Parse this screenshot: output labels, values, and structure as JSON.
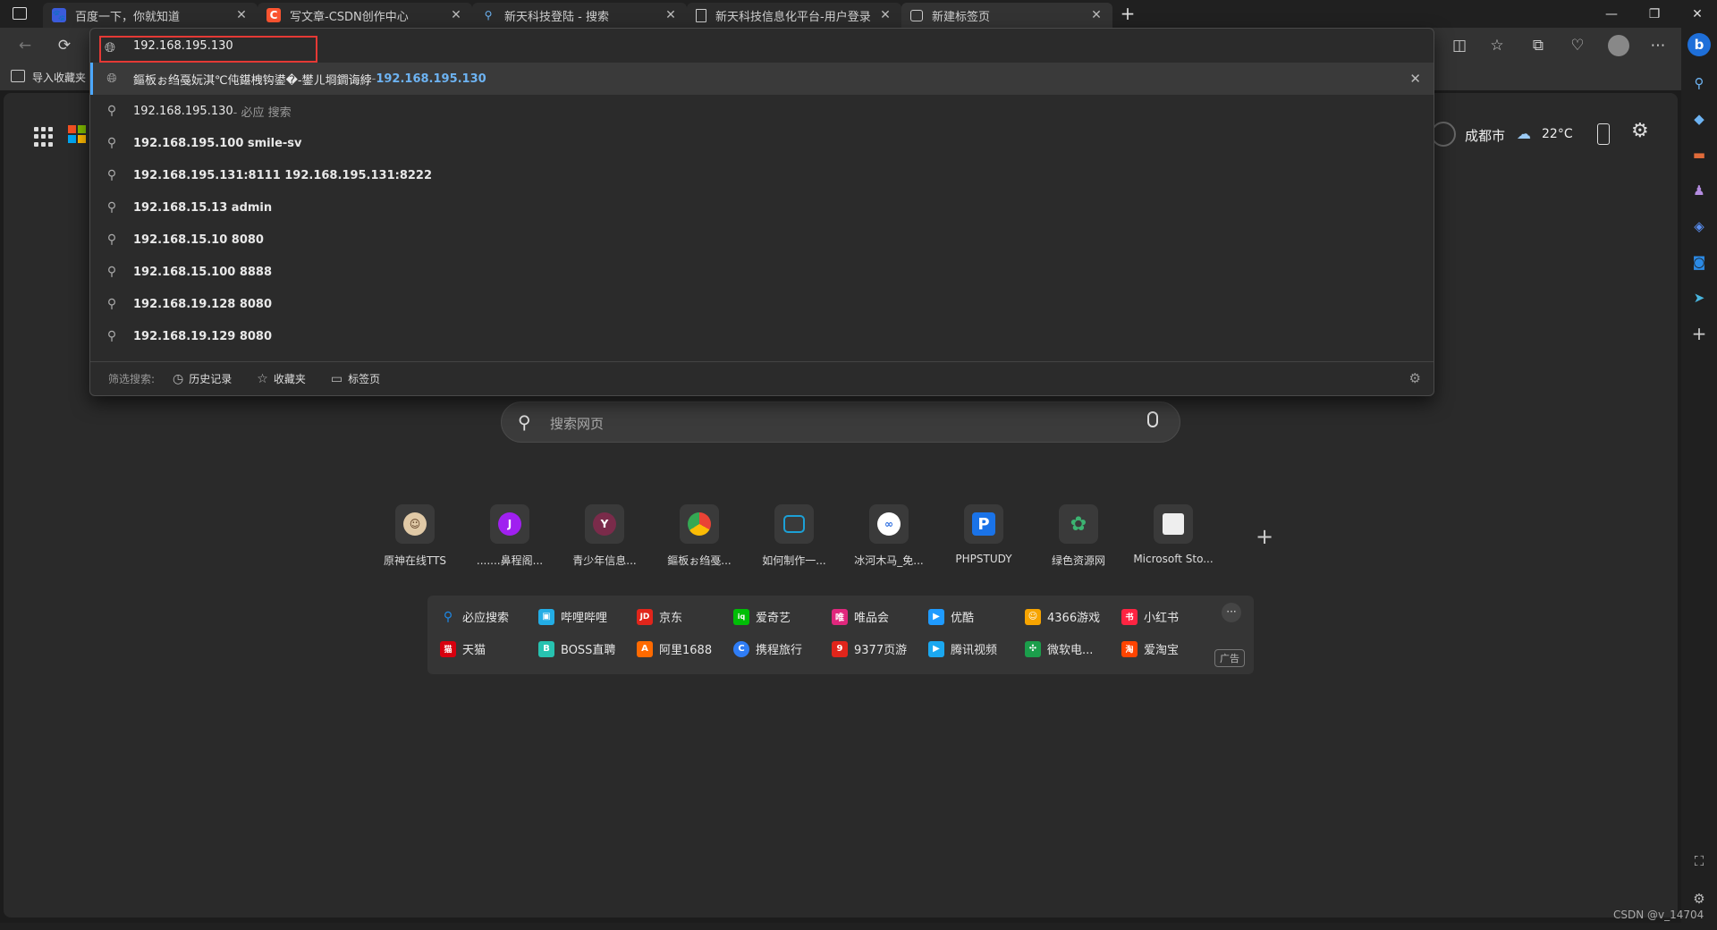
{
  "tabs": [
    {
      "label": "百度一下，你就知道",
      "icon": "baidu-paw-icon",
      "color": "#3b5bdb",
      "glyph": "🐾"
    },
    {
      "label": "写文章-CSDN创作中心",
      "icon": "csdn-icon",
      "color": "#fc5531",
      "glyph": "C"
    },
    {
      "label": "新天科技登陆 - 搜索",
      "icon": "search-icon",
      "color": "#2b2b2b",
      "glyph": "🔍"
    },
    {
      "label": "新天科技信息化平台-用户登录",
      "icon": "document-icon",
      "color": "#2b2b2b",
      "glyph": "▯"
    },
    {
      "label": "新建标签页",
      "icon": "newtab-icon",
      "color": "#2b2b2b",
      "glyph": "▣"
    }
  ],
  "favbar": {
    "import_label": "导入收藏夹"
  },
  "dropdown": {
    "address_value": "192.168.195.130",
    "history_title": "鏂板ぉ绉戞妧淇℃伅鍖栧钩鍙�-鐢ㄦ埛鐧诲綍",
    "history_separator": " - ",
    "history_url": "192.168.195.130",
    "search_row": {
      "query": "192.168.195.130",
      "suffix": " - 必应 搜索"
    },
    "suggestions": [
      "192.168.195.100 smile-sv",
      "192.168.195.131:8111 192.168.195.131:8222",
      "192.168.15.13 admin",
      "192.168.15.10 8080",
      "192.168.15.100 8888",
      "192.168.19.128 8080",
      "192.168.19.129 8080"
    ],
    "filter_label": "筛选搜索:",
    "filters": [
      "历史记录",
      "收藏夹",
      "标签页"
    ]
  },
  "weather": {
    "city": "成都市",
    "temp": "22°C"
  },
  "search": {
    "placeholder": "搜索网页"
  },
  "quicklinks": [
    {
      "label": "原神在线TTS",
      "color": "#e0c9a6",
      "glyph": "☺"
    },
    {
      "label": ".......鼻程阁...",
      "color": "#a020f0",
      "glyph": "J"
    },
    {
      "label": "青少年信息...",
      "color": "#7a2b4a",
      "glyph": "Y"
    },
    {
      "label": "鏂板ぉ绉戞...",
      "color": "#34a853",
      "glyph": "◉"
    },
    {
      "label": "如何制作一...",
      "color": "#1ca0d6",
      "glyph": "▣"
    },
    {
      "label": "冰河木马_免...",
      "color": "#2f6fe0",
      "glyph": "∞"
    },
    {
      "label": "PHPSTUDY",
      "color": "#1a73e8",
      "glyph": "P"
    },
    {
      "label": "绿色资源网",
      "color": "#2e8b57",
      "glyph": "✿"
    },
    {
      "label": "Microsoft Sto...",
      "color": "#555555",
      "glyph": "▦"
    }
  ],
  "ads": [
    {
      "label": "必应搜索",
      "color": "#1e88e5",
      "glyph": "🔍"
    },
    {
      "label": "哔哩哔哩",
      "color": "#23ade5",
      "glyph": "▣"
    },
    {
      "label": "京东",
      "color": "#e1251b",
      "glyph": "JD"
    },
    {
      "label": "爱奇艺",
      "color": "#00be06",
      "glyph": "iq"
    },
    {
      "label": "唯品会",
      "color": "#e0277d",
      "glyph": "唯"
    },
    {
      "label": "优酷",
      "color": "#1f9bff",
      "glyph": "▶"
    },
    {
      "label": "4366游戏",
      "color": "#f7a400",
      "glyph": "☺"
    },
    {
      "label": "小红书",
      "color": "#ff2442",
      "glyph": "书"
    },
    {
      "label": "天猫",
      "color": "#d7000f",
      "glyph": "猫"
    },
    {
      "label": "BOSS直聘",
      "color": "#27c2b0",
      "glyph": "B"
    },
    {
      "label": "阿里1688",
      "color": "#ff6a00",
      "glyph": "A"
    },
    {
      "label": "携程旅行",
      "color": "#2f7df6",
      "glyph": "C"
    },
    {
      "label": "9377页游",
      "color": "#e1251b",
      "glyph": "9"
    },
    {
      "label": "腾讯视频",
      "color": "#1ba8f0",
      "glyph": "▶"
    },
    {
      "label": "微软电...",
      "color": "#1b9e4b",
      "glyph": "✣"
    },
    {
      "label": "爱淘宝",
      "color": "#ff4400",
      "glyph": "淘"
    }
  ],
  "ad_badge": "广告",
  "watermark": "CSDN @v_14704"
}
